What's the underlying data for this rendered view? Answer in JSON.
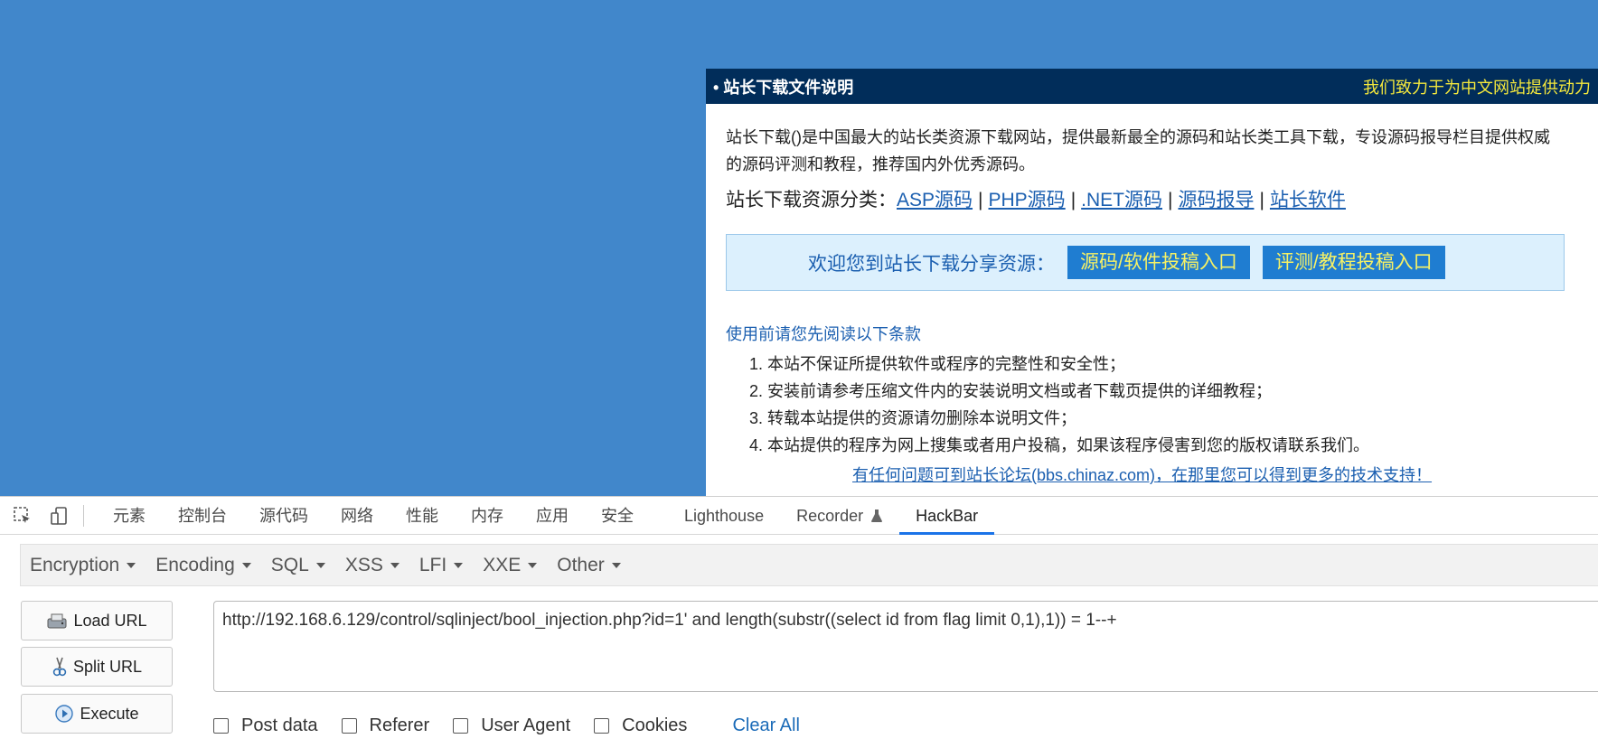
{
  "webpage": {
    "panel": {
      "title": "• 站长下载文件说明",
      "slogan": "我们致力于为中文网站提供动力",
      "intro": "站长下载()是中国最大的站长类资源下载网站，提供最新最全的源码和站长类工具下载，专设源码报导栏目提供权威的源码评测和教程，推荐国内外优秀源码。",
      "categories_label": "站长下载资源分类：",
      "categories": [
        "ASP源码",
        "PHP源码",
        ".NET源码",
        "源码报导",
        "站长软件"
      ],
      "share_text": "欢迎您到站长下载分享资源：",
      "share_buttons": [
        "源码/软件投稿入口",
        "评测/教程投稿入口"
      ],
      "terms_title": "使用前请您先阅读以下条款",
      "terms": [
        "本站不保证所提供软件或程序的完整性和安全性；",
        "安装前请参考压缩文件内的安装说明文档或者下载页提供的详细教程；",
        "转载本站提供的资源请勿删除本说明文件；",
        "本站提供的程序为网上搜集或者用户投稿，如果该程序侵害到您的版权请联系我们。"
      ],
      "forum_link": "有任何问题可到站长论坛(bbs.chinaz.com)，在那里您可以得到更多的技术支持！"
    }
  },
  "devtools": {
    "icons": [
      "inspect-icon",
      "device-toggle-icon"
    ],
    "tabs": [
      "元素",
      "控制台",
      "源代码",
      "网络",
      "性能",
      "内存",
      "应用",
      "安全",
      "Lighthouse",
      "Recorder",
      "HackBar"
    ],
    "active_tab": "HackBar"
  },
  "hackbar": {
    "menu": [
      "Encryption",
      "Encoding",
      "SQL",
      "XSS",
      "LFI",
      "XXE",
      "Other"
    ],
    "buttons": {
      "load": "Load URL",
      "split": "Split URL",
      "execute": "Execute"
    },
    "url": "http://192.168.6.129/control/sqlinject/bool_injection.php?id=1' and length(substr((select id from flag limit 0,1),1)) = 1--+",
    "options": [
      "Post data",
      "Referer",
      "User Agent",
      "Cookies"
    ],
    "clear_all": "Clear All"
  },
  "colors": {
    "page_bg": "#4187cb",
    "panel_header_bg": "#012d5a",
    "slogan": "#f4e83c",
    "link": "#1b5fb0",
    "share_button_bg": "#1f7dd1",
    "share_button_text": "#f8f264",
    "active_tab_underline": "#1a73e8"
  }
}
